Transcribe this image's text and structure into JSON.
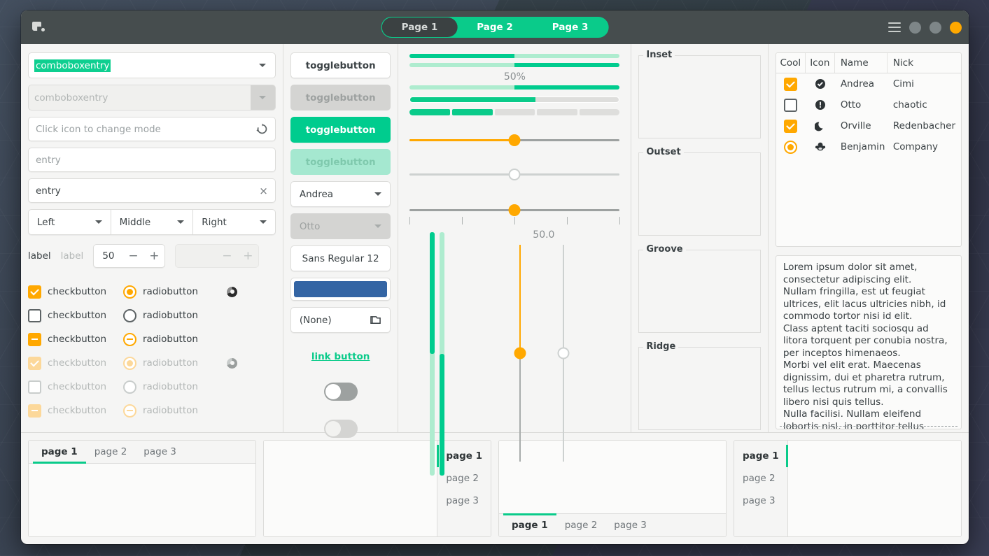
{
  "window": {
    "app_icon": "app-icon",
    "menu_icon": "hamburger-menu-icon",
    "stack_switcher": [
      {
        "label": "Page 1",
        "active": true
      },
      {
        "label": "Page 2",
        "active": false
      },
      {
        "label": "Page 3",
        "active": false
      }
    ]
  },
  "left_pane": {
    "comboboxentry_selected": "comboboxentry",
    "comboboxentry_disabled": "comboboxentry",
    "entry_icon_mode": "Click icon to change mode",
    "entry_placeholder": "entry",
    "entry_value": "entry",
    "entry_clear_icon": "clear-icon",
    "reload_icon": "reload-icon",
    "linked_combos": [
      "Left",
      "Middle",
      "Right"
    ],
    "label_enabled": "label",
    "label_disabled": "label",
    "spin_value": "50",
    "spin_minus": "−",
    "spin_plus": "+",
    "spin_disabled_value": "",
    "checkbuttons": [
      {
        "label": "checkbutton",
        "state": "checked",
        "disabled": false
      },
      {
        "label": "checkbutton",
        "state": "unchecked",
        "disabled": false
      },
      {
        "label": "checkbutton",
        "state": "indeterminate",
        "disabled": false
      },
      {
        "label": "checkbutton",
        "state": "checked",
        "disabled": true
      },
      {
        "label": "checkbutton",
        "state": "unchecked",
        "disabled": true
      },
      {
        "label": "checkbutton",
        "state": "indeterminate",
        "disabled": true
      }
    ],
    "radiobuttons": [
      {
        "label": "radiobutton",
        "state": "checked",
        "disabled": false
      },
      {
        "label": "radiobutton",
        "state": "unchecked",
        "disabled": false
      },
      {
        "label": "radiobutton",
        "state": "indeterminate",
        "disabled": false
      },
      {
        "label": "radiobutton",
        "state": "checked",
        "disabled": true
      },
      {
        "label": "radiobutton",
        "state": "unchecked",
        "disabled": true
      },
      {
        "label": "radiobutton",
        "state": "indeterminate",
        "disabled": true
      }
    ],
    "spinners": [
      "spinner-icon",
      "spinner-icon-disabled"
    ]
  },
  "mid_pane": {
    "togglebuttons": [
      {
        "label": "togglebutton",
        "state": "normal"
      },
      {
        "label": "togglebutton",
        "state": "disabled"
      },
      {
        "label": "togglebutton",
        "state": "active"
      },
      {
        "label": "togglebutton",
        "state": "active-disabled"
      }
    ],
    "combo_enabled": "Andrea",
    "combo_disabled": "Otto",
    "font_button": "Sans Regular  12",
    "color_button_value": "#3465a4",
    "file_button": "(None)",
    "file_button_icon": "folder-icon",
    "link_button": "link button",
    "switch_on": false,
    "switch_disabled": true
  },
  "slider_pane": {
    "progress_percent_text": "50%",
    "progressbars": [
      {
        "value": 50,
        "inverted": false
      },
      {
        "value": 50,
        "inverted": true
      },
      {
        "value": 50,
        "inverted": true
      }
    ],
    "levelbar_continuous": 60,
    "levelbar_discrete": [
      true,
      true,
      false,
      false,
      false
    ],
    "scales": [
      {
        "value": 50,
        "disabled": false,
        "marks": false
      },
      {
        "value": 50,
        "disabled": true,
        "marks": false
      },
      {
        "value": 50,
        "disabled": false,
        "marks": true
      }
    ],
    "scale_value_label": "50.0",
    "vertical_progressbars": [
      {
        "value": 50,
        "inverted": false
      },
      {
        "value": 50,
        "inverted": true
      }
    ],
    "vertical_scales": [
      {
        "value": 50,
        "disabled": false
      },
      {
        "value": 50,
        "disabled": true
      }
    ]
  },
  "frames": [
    {
      "title": "Inset"
    },
    {
      "title": "Outset"
    },
    {
      "title": "Groove"
    },
    {
      "title": "Ridge"
    }
  ],
  "treeview": {
    "columns": [
      "Cool",
      "Icon",
      "Name",
      "Nick"
    ],
    "rows": [
      {
        "cool": "checked",
        "icon": "check-circle-icon",
        "glyph": "✔",
        "name": "Andrea",
        "nick": "Cimi"
      },
      {
        "cool": "unchecked",
        "icon": "warning-icon",
        "glyph": "!",
        "name": "Otto",
        "nick": "chaotic"
      },
      {
        "cool": "checked",
        "icon": "moon-icon",
        "glyph": "☾",
        "name": "Orville",
        "nick": "Redenbacher"
      },
      {
        "cool": "radio-on",
        "icon": "monkey-icon",
        "glyph": "࿋",
        "name": "Benjamin",
        "nick": "Company"
      }
    ]
  },
  "textview": {
    "content": "Lorem ipsum dolor sit amet, consectetur adipiscing elit.\nNullam fringilla, est ut feugiat ultrices, elit lacus ultricies nibh, id commodo tortor nisi id elit.\nClass aptent taciti sociosqu ad litora torquent per conubia nostra, per inceptos himenaeos.\nMorbi vel elit erat. Maecenas dignissim, dui et pharetra rutrum, tellus lectus rutrum mi, a convallis libero nisi quis tellus.\nNulla facilisi. Nullam eleifend lobortis nisl, in porttitor tellus malesuada vitae."
  },
  "notebooks": [
    {
      "position": "top",
      "tabs": [
        "page 1",
        "page 2",
        "page 3"
      ],
      "active": 0
    },
    {
      "position": "right",
      "tabs": [
        "page 1",
        "page 2",
        "page 3"
      ],
      "active": 0
    },
    {
      "position": "bottom",
      "tabs": [
        "page 1",
        "page 2",
        "page 3"
      ],
      "active": 0
    },
    {
      "position": "left",
      "tabs": [
        "page 1",
        "page 2",
        "page 3"
      ],
      "active": 0
    }
  ],
  "colors": {
    "accent_green": "#0acb8a",
    "accent_orange": "#ffa800",
    "headerbar": "#464d4e",
    "background": "#f5f5f4",
    "close_button": "#ffa800"
  }
}
